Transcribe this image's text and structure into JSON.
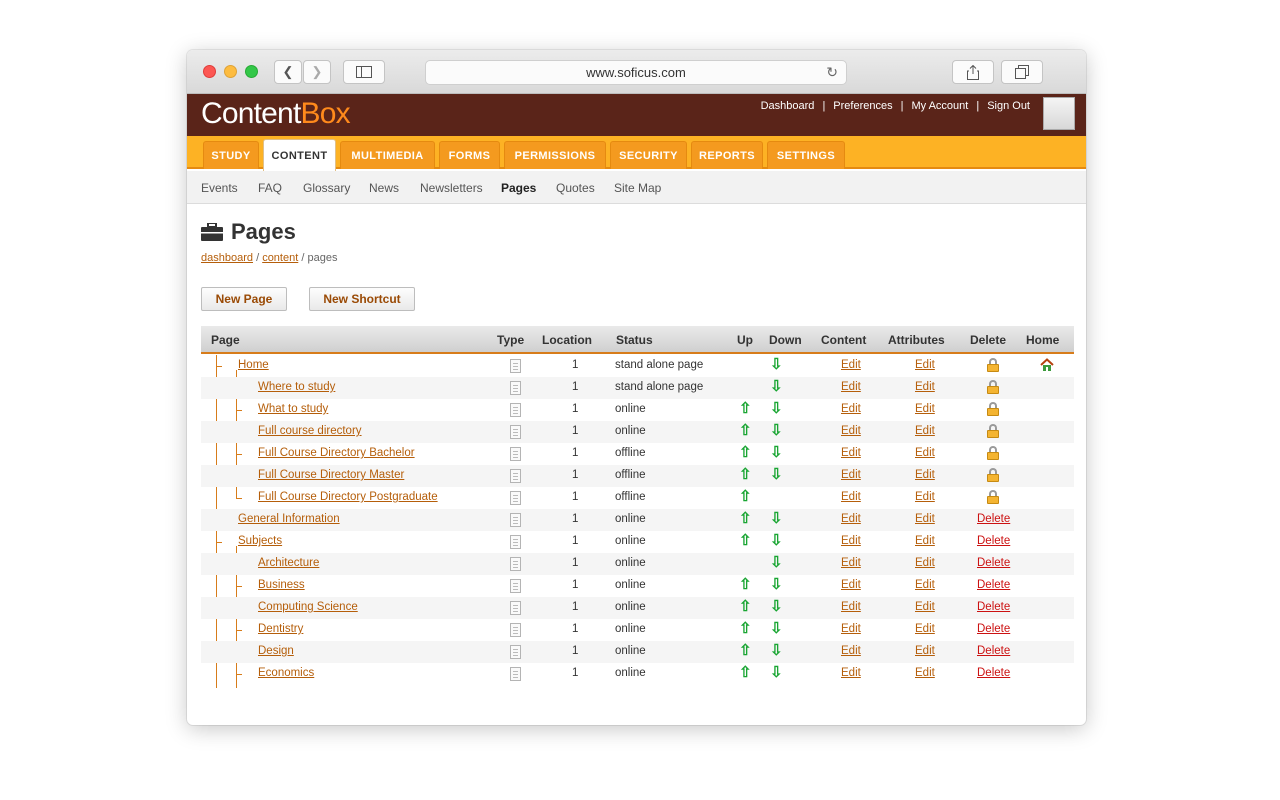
{
  "browser": {
    "url": "www.soficus.com"
  },
  "app": {
    "logo_a": "Content",
    "logo_b": "Box",
    "top_links": [
      "Dashboard",
      "|",
      "Preferences",
      "|",
      "My Account",
      "|",
      "Sign Out"
    ]
  },
  "tabs": [
    {
      "label": "STUDY",
      "active": false
    },
    {
      "label": "CONTENT",
      "active": true
    },
    {
      "label": "MULTIMEDIA",
      "active": false
    },
    {
      "label": "FORMS",
      "active": false
    },
    {
      "label": "PERMISSIONS",
      "active": false
    },
    {
      "label": "SECURITY",
      "active": false
    },
    {
      "label": "REPORTS",
      "active": false
    },
    {
      "label": "SETTINGS",
      "active": false
    }
  ],
  "subnav": [
    "Events",
    "FAQ",
    "Glossary",
    "News",
    "Newsletters",
    "Pages",
    "Quotes",
    "Site Map"
  ],
  "subnav_active": "Pages",
  "page": {
    "title": "Pages",
    "breadcrumb": {
      "home": "dashboard",
      "sep": "/",
      "parent": "content",
      "current": "pages"
    },
    "new_page": "New Page",
    "new_shortcut": "New Shortcut"
  },
  "table": {
    "columns": [
      "Page",
      "Type",
      "Location",
      "Status",
      "Up",
      "Down",
      "Content",
      "Attributes",
      "Delete",
      "Home"
    ],
    "edit_label": "Edit",
    "delete_label": "Delete",
    "rows": [
      {
        "name": "Home",
        "level": 1,
        "location": "1",
        "status": "stand alone page",
        "up": false,
        "down": true,
        "delete": "locked",
        "home": true
      },
      {
        "name": "Where to study",
        "level": 2,
        "location": "1",
        "status": "stand alone page",
        "up": false,
        "down": true,
        "delete": "locked",
        "home": false
      },
      {
        "name": "What to study",
        "level": 2,
        "location": "1",
        "status": "online",
        "up": true,
        "down": true,
        "delete": "locked",
        "home": false
      },
      {
        "name": "Full course directory",
        "level": 2,
        "location": "1",
        "status": "online",
        "up": true,
        "down": true,
        "delete": "locked",
        "home": false
      },
      {
        "name": "Full Course Directory Bachelor",
        "level": 2,
        "location": "1",
        "status": "offline",
        "up": true,
        "down": true,
        "delete": "locked",
        "home": false
      },
      {
        "name": "Full Course Directory Master",
        "level": 2,
        "location": "1",
        "status": "offline",
        "up": true,
        "down": true,
        "delete": "locked",
        "home": false
      },
      {
        "name": "Full Course Directory Postgraduate",
        "level": 2,
        "location": "1",
        "status": "offline",
        "up": true,
        "down": false,
        "delete": "locked",
        "home": false
      },
      {
        "name": "General Information",
        "level": 1,
        "location": "1",
        "status": "online",
        "up": true,
        "down": true,
        "delete": "link",
        "home": false
      },
      {
        "name": "Subjects",
        "level": 1,
        "location": "1",
        "status": "online",
        "up": true,
        "down": true,
        "delete": "link",
        "home": false
      },
      {
        "name": "Architecture",
        "level": 2,
        "location": "1",
        "status": "online",
        "up": false,
        "down": true,
        "delete": "link",
        "home": false
      },
      {
        "name": "Business",
        "level": 2,
        "location": "1",
        "status": "online",
        "up": true,
        "down": true,
        "delete": "link",
        "home": false
      },
      {
        "name": "Computing Science",
        "level": 2,
        "location": "1",
        "status": "online",
        "up": true,
        "down": true,
        "delete": "link",
        "home": false
      },
      {
        "name": "Dentistry",
        "level": 2,
        "location": "1",
        "status": "online",
        "up": true,
        "down": true,
        "delete": "link",
        "home": false
      },
      {
        "name": "Design",
        "level": 2,
        "location": "1",
        "status": "online",
        "up": true,
        "down": true,
        "delete": "link",
        "home": false
      },
      {
        "name": "Economics",
        "level": 2,
        "location": "1",
        "status": "online",
        "up": true,
        "down": true,
        "delete": "link",
        "home": false
      }
    ]
  },
  "colors": {
    "header_bg": "#5a2419",
    "tab_bar": "#fdb224",
    "tab": "#f49a1f",
    "accent": "#d77c1a",
    "link": "#b55e0a",
    "delete": "#cc1111",
    "arrow": "#19a532"
  }
}
